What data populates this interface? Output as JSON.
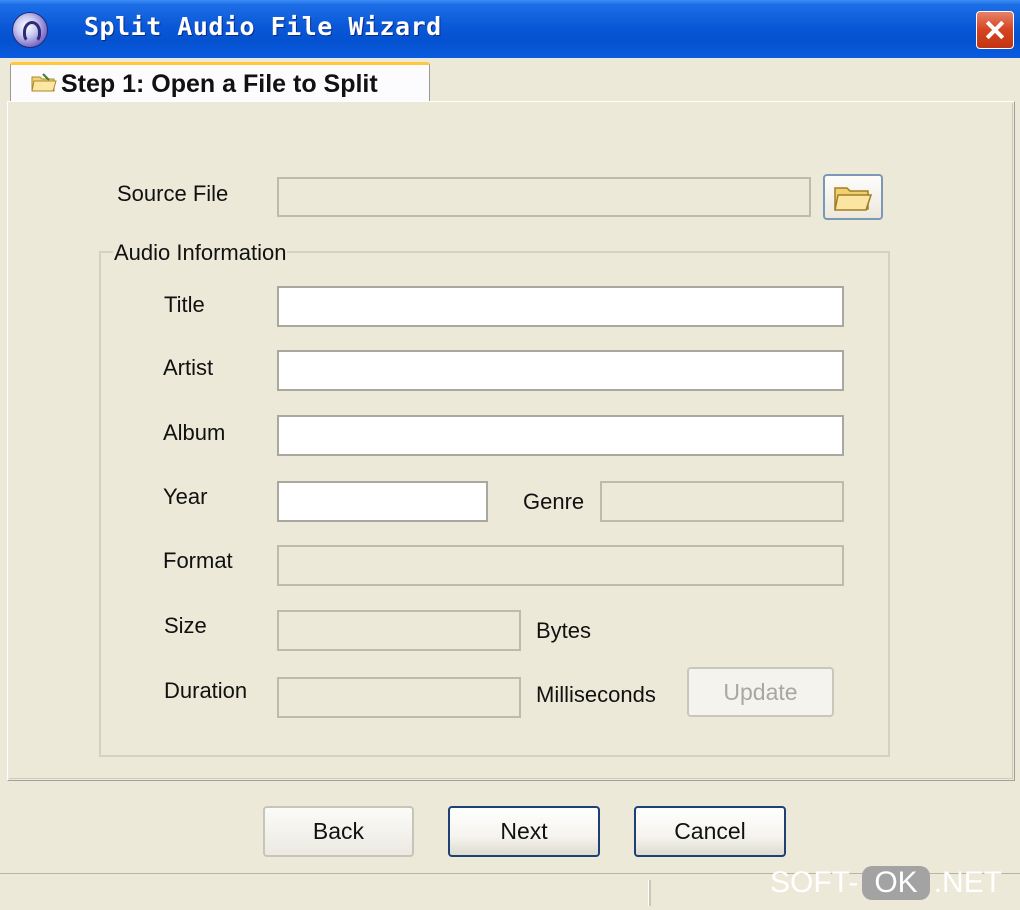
{
  "window": {
    "title": "Split Audio File Wizard"
  },
  "tab": {
    "label": "Step 1:  Open a File to Split"
  },
  "source": {
    "label": "Source File",
    "value": ""
  },
  "audio_info": {
    "group_title": "Audio Information",
    "title_label": "Title",
    "artist_label": "Artist",
    "album_label": "Album",
    "year_label": "Year",
    "genre_label": "Genre",
    "format_label": "Format",
    "size_label": "Size",
    "size_unit": "Bytes",
    "duration_label": "Duration",
    "duration_unit": "Milliseconds",
    "update_label": "Update"
  },
  "buttons": {
    "back": "Back",
    "next": "Next",
    "cancel": "Cancel"
  },
  "watermark": {
    "left": "SOFT-",
    "ok": "OK",
    "right": ".NET"
  },
  "colors": {
    "titlebar": "#0a58d8",
    "close": "#d6431f",
    "tab_accent": "#ffc83c",
    "face": "#ece9d8"
  }
}
